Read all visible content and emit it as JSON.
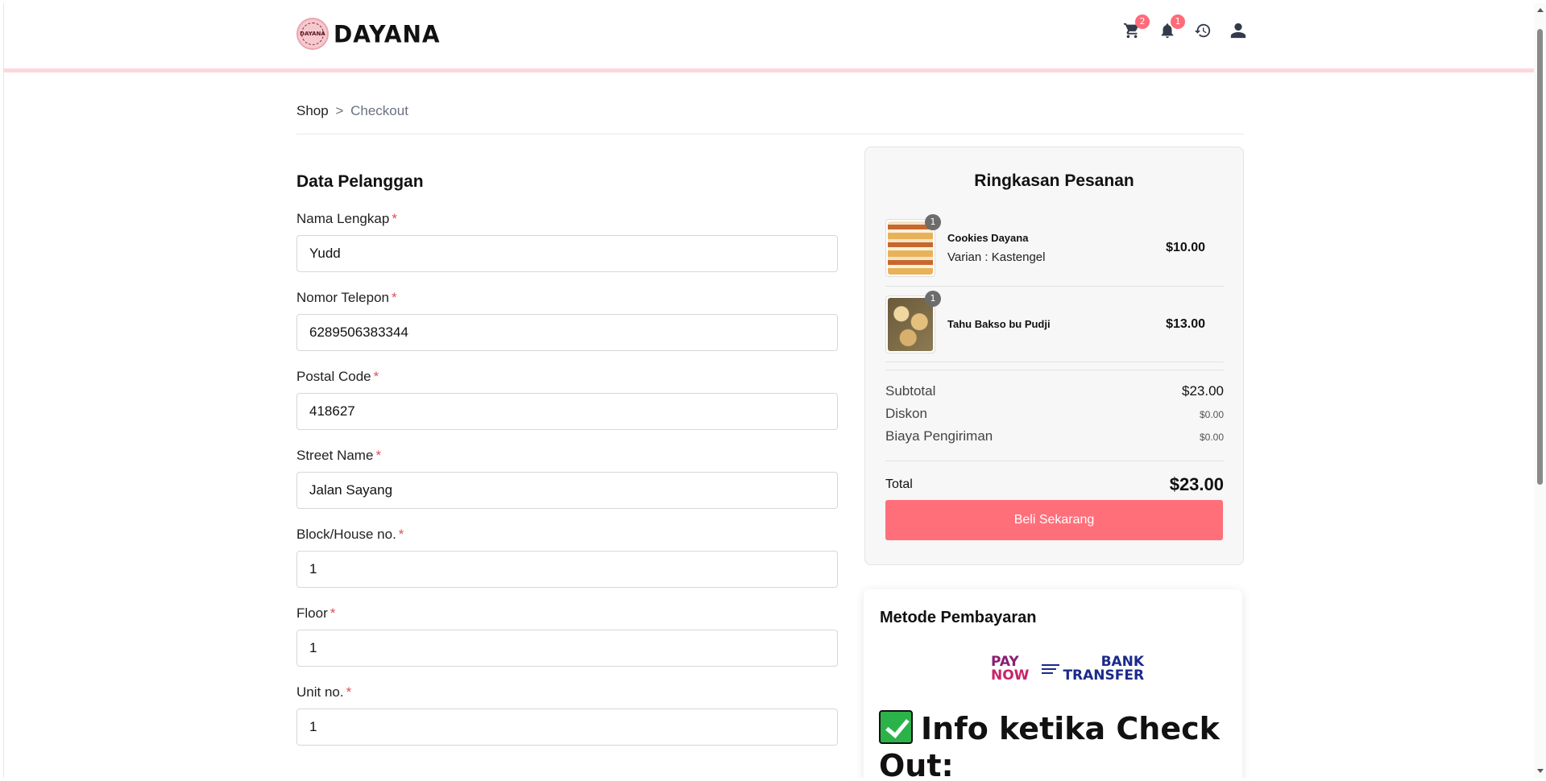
{
  "brand": {
    "name": "DAYANA",
    "badge_text": "DAYANA"
  },
  "header": {
    "icons": [
      {
        "name": "cart-icon",
        "badge": "2"
      },
      {
        "name": "bell-icon",
        "badge": "1"
      },
      {
        "name": "history-icon"
      },
      {
        "name": "user-icon"
      }
    ]
  },
  "breadcrumb": {
    "root": "Shop",
    "separator": ">",
    "current": "Checkout"
  },
  "form": {
    "title": "Data Pelanggan",
    "required_mark": "*",
    "fields": [
      {
        "label": "Nama Lengkap",
        "value": "Yudd"
      },
      {
        "label": "Nomor Telepon",
        "value": "6289506383344"
      },
      {
        "label": "Postal Code",
        "value": "418627"
      },
      {
        "label": "Street Name",
        "value": "Jalan Sayang"
      },
      {
        "label": "Block/House no.",
        "value": "1"
      },
      {
        "label": "Floor",
        "value": "1"
      },
      {
        "label": "Unit no.",
        "value": "1"
      }
    ]
  },
  "summary": {
    "title": "Ringkasan Pesanan",
    "items": [
      {
        "name": "Cookies Dayana",
        "variant": "Varian : Kastengel",
        "price": "$10.00",
        "qty": "1"
      },
      {
        "name": "Tahu Bakso bu Pudji",
        "variant": "",
        "price": "$13.00",
        "qty": "1"
      }
    ],
    "subtotal_label": "Subtotal",
    "subtotal": "$23.00",
    "discount_label": "Diskon",
    "discount": "$0.00",
    "shipping_label": "Biaya Pengiriman",
    "shipping": "$0.00",
    "total_label": "Total",
    "total": "$23.00",
    "buy_button": "Beli Sekarang"
  },
  "payment": {
    "title": "Metode Pembayaran",
    "paynow_line1": "PAY",
    "paynow_line2": "NOW",
    "bank_line1": "BANK",
    "bank_line2": "TRANSFER",
    "info_heading": "Info ketika Check Out:"
  },
  "colors": {
    "accent": "#ff6f7a",
    "badge": "#ff6b78",
    "header_border": "#ffd6dc",
    "required": "#e34b5a"
  }
}
